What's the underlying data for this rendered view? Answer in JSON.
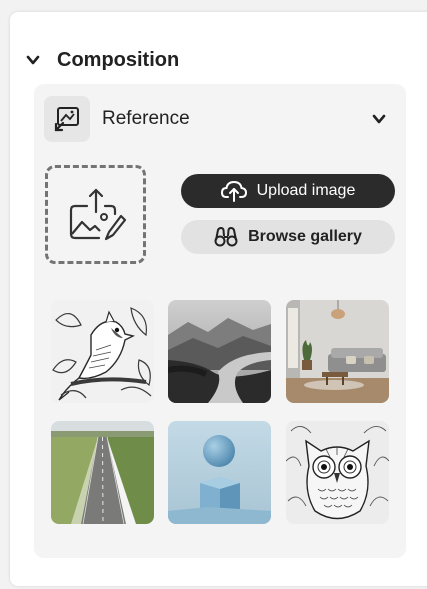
{
  "section": {
    "title": "Composition",
    "icon": "chevron-down-icon"
  },
  "reference": {
    "title": "Reference",
    "icon": "reference-image-icon",
    "toggle_icon": "chevron-down-icon"
  },
  "actions": {
    "upload_label": "Upload image",
    "upload_icon": "cloud-upload-icon",
    "browse_label": "Browse gallery",
    "browse_icon": "binoculars-icon"
  },
  "drop_zone": {
    "icon": "image-upload-icon"
  },
  "gallery": [
    {
      "subject": "bird-line-art"
    },
    {
      "subject": "misty-river-valley"
    },
    {
      "subject": "living-room-interior"
    },
    {
      "subject": "straight-road-through-fields"
    },
    {
      "subject": "sphere-on-cube"
    },
    {
      "subject": "owl-line-art"
    }
  ],
  "colors": {
    "primary_button": "#2b2b2b",
    "secondary_button": "#e2e2e2",
    "card_background": "#f4f4f4"
  }
}
